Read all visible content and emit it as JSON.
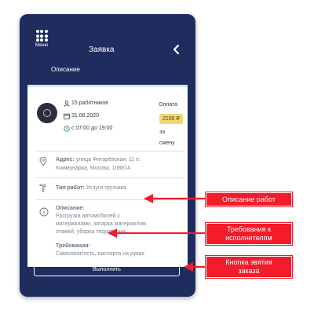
{
  "header": {
    "menu_label": "Меню",
    "title": "Заявка",
    "subtitle": "Описание"
  },
  "job": {
    "workers": "15 работников",
    "date": "31.08.2020",
    "time": "с 07:00 до 19:00",
    "pay_label": "Оплата",
    "price": "2100 ₽",
    "per_1": "за",
    "per_2": "смену",
    "address_label": "Адрес:",
    "address_value_1": "улица Фитарёвская, 11 п.",
    "address_value_2": "Коммунарка, Москва, 108814",
    "worktype_label": "Тип работ:",
    "worktype_value": "Услуги грузчика",
    "description_label": "Описание:",
    "description_1": "Разгрузка автомобилей с",
    "description_2": "материалами, затарка материалом",
    "description_3": "этажей, уборка территории",
    "requirements_label": "Требования:",
    "requirements_value": "Самозанятость, паспорта на руках"
  },
  "submit_label": "Выполнить",
  "annotations": {
    "description_callout": "Описание работ",
    "requirements_callout_1": "Требования к",
    "requirements_callout_2": "исполнителям",
    "button_callout_1": "Кнопка звятия",
    "button_callout_2": "заказа"
  },
  "colors": {
    "app_background": "#1e2d5e",
    "price_badge": "#f5d66b",
    "callout": "#f21c2b"
  }
}
